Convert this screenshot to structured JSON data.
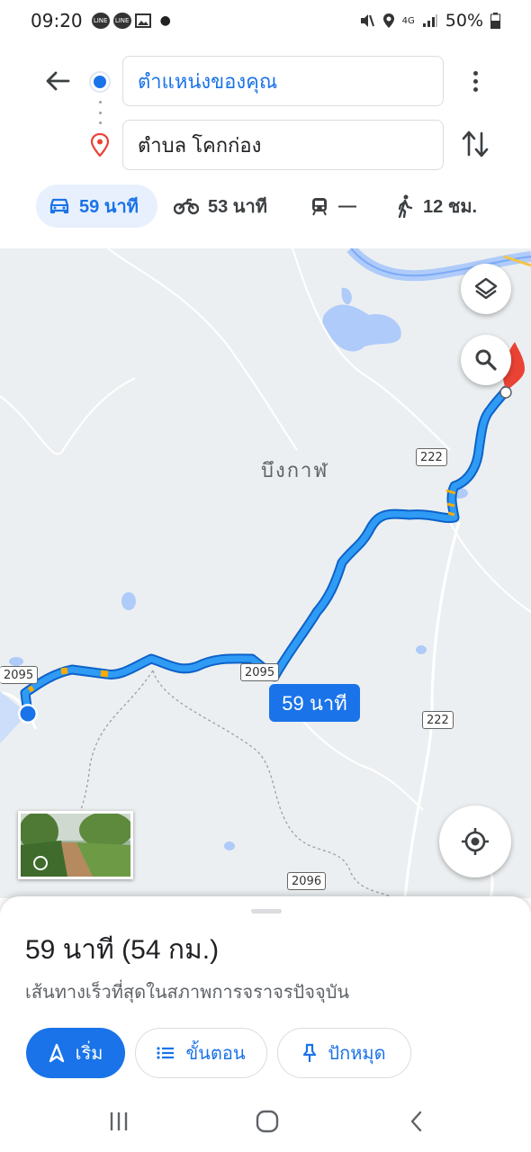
{
  "status_bar": {
    "time": "09:20",
    "battery": "50%",
    "network": "4G"
  },
  "directions": {
    "origin": "ตำแหน่งของคุณ",
    "destination": "ตำบล โคกก่อง"
  },
  "modes": [
    {
      "name": "car",
      "label": "59 นาที",
      "active": true
    },
    {
      "name": "motorcycle",
      "label": "53 นาที"
    },
    {
      "name": "transit",
      "label": "—"
    },
    {
      "name": "walk",
      "label": "12 ชม."
    }
  ],
  "map": {
    "place_label": "บึงกาฬ",
    "route_time": "59 นาที",
    "shields": [
      "222",
      "2095",
      "2095",
      "222",
      "2096"
    ]
  },
  "sheet": {
    "summary": "59 นาที (54 กม.)",
    "subtitle": "เส้นทางเร็วที่สุดในสภาพการจราจรปัจจุบัน",
    "start_label": "เริ่ม",
    "steps_label": "ขั้นตอน",
    "pin_label": "ปักหมุด"
  },
  "colors": {
    "accent": "#1a73e8",
    "route": "#2196f3",
    "destination_pin": "#ea4335"
  }
}
